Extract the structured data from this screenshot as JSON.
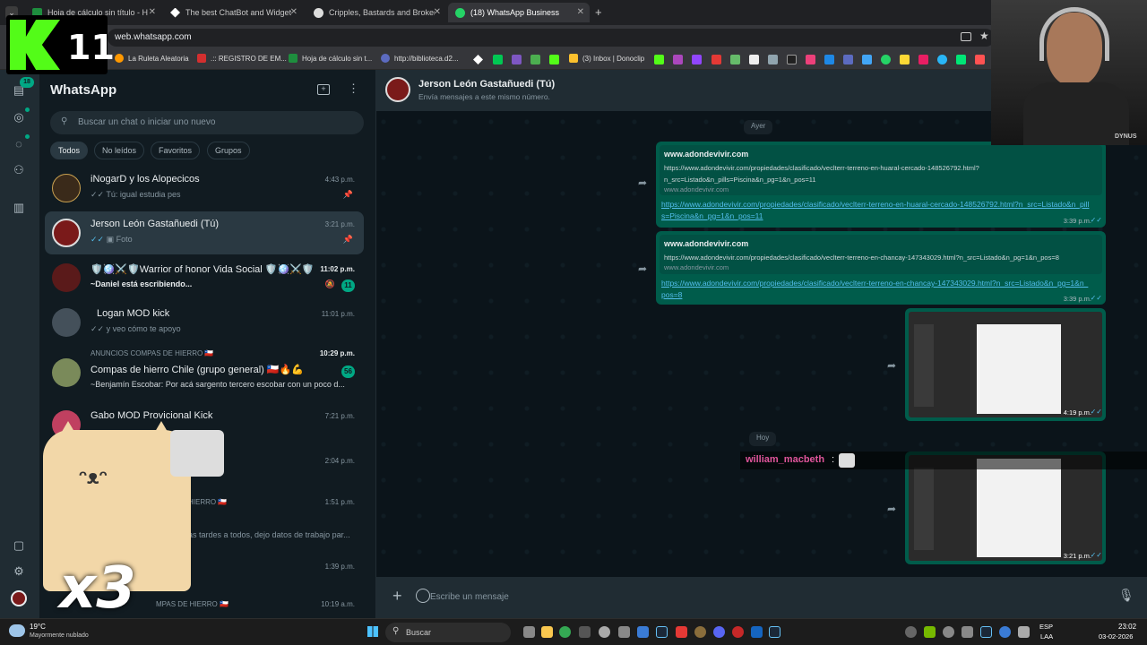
{
  "browser": {
    "tabs": [
      {
        "title": "Hoja de cálculo sin título - Hoja",
        "color": "#1e8e3e"
      },
      {
        "title": "The best ChatBot and Widgets",
        "color": "#ffffff"
      },
      {
        "title": "Cripples, Bastards and Broken T",
        "color": "#ffffff"
      },
      {
        "title": "(18) WhatsApp Business",
        "color": "#25d366"
      }
    ],
    "url": "web.whatsapp.com",
    "bookmarks": [
      {
        "label": "La Ruleta Aleatoria",
        "color": "#ff9800"
      },
      {
        "label": ".:: REGISTRO DE EM...",
        "color": "#d32f2f"
      },
      {
        "label": "Hoja de cálculo sin t...",
        "color": "#1e8e3e"
      },
      {
        "label": "http://biblioteca.d2...",
        "color": "#5c6bc0"
      },
      {
        "label": "(3) Inbox | Donoclip",
        "color": "#fbc02d"
      }
    ]
  },
  "kick": {
    "number": "11"
  },
  "sidebar": {
    "unread_count": "18",
    "title": "WhatsApp",
    "search_placeholder": "Buscar un chat o iniciar uno nuevo",
    "filters": [
      "Todos",
      "No leídos",
      "Favoritos",
      "Grupos"
    ],
    "chats": [
      {
        "name": "iNogarD y los Alopecicos",
        "preview": "Tú: igual estudia pes",
        "time": "4:43 p.m.",
        "avatar_color": "#3a2a1a"
      },
      {
        "name": "Jerson León Gastañuedi (Tú)",
        "preview": "Foto",
        "time": "3:21 p.m.",
        "avatar_color": "#7a1a1a"
      },
      {
        "name": "🛡️🪩⚔️🛡️Warrior of honor Vida Social 🛡️🪩⚔️🛡️",
        "preview": "~Daniel está escribiendo...",
        "time": "11:02 p.m.",
        "badge": "11",
        "avatar_color": "#5a1a1a"
      },
      {
        "name": "Logan MOD kick",
        "preview": "y veo cómo te apoyo",
        "time": "11:01 p.m.",
        "avatar_color": "#44505a"
      },
      {
        "group": "ANUNCIOS COMPAS DE HIERRO 🇨🇱",
        "name": "Compas de hierro Chile (grupo general) 🇨🇱🔥💪",
        "preview": "~Benjamín Escobar: Por acá sargento tercero escobar con un poco d...",
        "time": "10:29 p.m.",
        "badge": "56",
        "avatar_color": "#7a8a5a"
      },
      {
        "name": "Gabo MOD Provicional Kick",
        "preview": "",
        "time": "7:21 p.m.",
        "avatar_color": "#c04060"
      },
      {
        "name": "",
        "preview": "",
        "time": "2:04 p.m.",
        "avatar_color": "#1b2830"
      },
      {
        "group": "HIERRO 🇨🇱",
        "name": "",
        "preview": "as tardes a todos, dejo datos de trabajo par...",
        "time": "1:51 p.m.",
        "avatar_color": "#1b2830"
      },
      {
        "name": "",
        "preview": "",
        "time": "1:39 p.m.",
        "avatar_color": "#1b2830"
      },
      {
        "group": "MPAS DE HIERRO 🇨🇱",
        "name": "",
        "preview": "",
        "time": "10:19 a.m.",
        "avatar_color": "#1b2830"
      }
    ]
  },
  "chat": {
    "contact": "Jerson León Gastañuedi (Tú)",
    "subtitle": "Envía mensajes a este mismo número.",
    "day_yesterday": "Ayer",
    "day_today": "Hoy",
    "messages": [
      {
        "preview_title": "www.adondevivir.com",
        "preview_desc": "https://www.adondevivir.com/propiedades/clasificado/veclterr-terreno-en-huaral-cercado-148526792.html?n_src=Listado&n_pills=Piscina&n_pg=1&n_pos=11",
        "preview_domain": "www.adondevivir.com",
        "link": "https://www.adondevivir.com/propiedades/clasificado/veclterr-terreno-en-huaral-cercado-148526792.html?n_src=Listado&n_pills=Piscina&n_pg=1&n_pos=11",
        "time": "3:39 p.m."
      },
      {
        "preview_title": "www.adondevivir.com",
        "preview_desc": "https://www.adondevivir.com/propiedades/clasificado/veclterr-terreno-en-chancay-147343029.html?n_src=Listado&n_pg=1&n_pos=8",
        "preview_domain": "www.adondevivir.com",
        "link": "https://www.adondevivir.com/propiedades/clasificado/veclterr-terreno-en-chancay-147343029.html?n_src=Listado&n_pg=1&n_pos=8",
        "time": "3:39 p.m."
      },
      {
        "type": "image",
        "time": "4:19 p.m."
      },
      {
        "type": "image",
        "time": "3:21 p.m."
      }
    ],
    "composer_placeholder": "Escribe un mensaje"
  },
  "stream": {
    "viewer_name": "william_macbeth",
    "viewer_color": "#e0559b",
    "cam_label": "DYNUS",
    "cat_multiplier": "x3"
  },
  "taskbar": {
    "weather_temp": "19°C",
    "weather_desc": "Mayormente nublado",
    "search_label": "Buscar",
    "lang_top": "ESP",
    "lang_bottom": "LAA",
    "clock_time": "23:02",
    "clock_date": "03-02-2026"
  }
}
